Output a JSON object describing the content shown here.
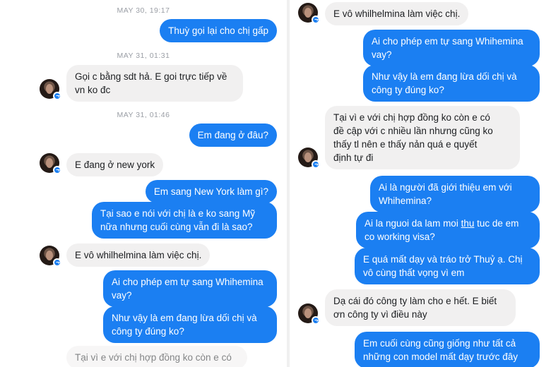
{
  "left": {
    "timestamps": [
      "MAY 30, 19:17",
      "MAY 31, 01:31",
      "MAY 31, 01:46"
    ],
    "messages": [
      "Thuỳ gọi lại cho chị gấp",
      "Gọi c bằng sdt hả. E goi trực tiếp về\nvn ko đc",
      "Em đang ở đâu?",
      "E đang ở new york",
      "Em sang New York làm gì?",
      "Tại sao e nói với chị là e ko sang Mỹ\nnữa nhưng cuối cùng vẫn đi là sao?",
      "E vô whilhelmina làm việc chị.",
      "Ai cho phép em tự sang Whihemina\nvay?",
      "Như vậy là em đang lừa dối chị và\ncông ty đúng ko?",
      "Tại vì e với chị hợp đồng ko còn e có"
    ]
  },
  "right": {
    "messages": [
      "E vô whilhelmina làm việc chị.",
      "Ai cho phép em tự sang Whihemina\nvay?",
      "Như vậy là em đang lừa dối chị và\ncông ty đúng ko?",
      "Tại vì e với chị hợp đồng ko còn e có\nđề cập với c nhiều lần nhưng cũng ko\nthấy tl nên e thấy nản quá e quyết\nđịnh tự đi",
      "Ai là người đã giới thiệu em với\nWhihemina?",
      "Ai la nguoi da lam moi ",
      "thu",
      " tuc de em\nco working visa?",
      "E quá mất dạy và tráo trở Thuỷ ạ. Chị\nvô cùng thất vọng vì em",
      "Dạ cái đó công ty làm cho e hết. E biết\nơn công ty vì điều này",
      "Em cuối cùng cũng giống như tất cả\nnhững con model mất dạy trước đây"
    ]
  },
  "colors": {
    "outgoing_bubble": "#1b7ff2",
    "incoming_bubble": "#f1f0f0",
    "timestamp_text": "#9a9ea5",
    "badge": "#1b7ff2"
  },
  "icons": {
    "avatar": "contact-avatar",
    "badge": "messenger-badge-icon"
  }
}
